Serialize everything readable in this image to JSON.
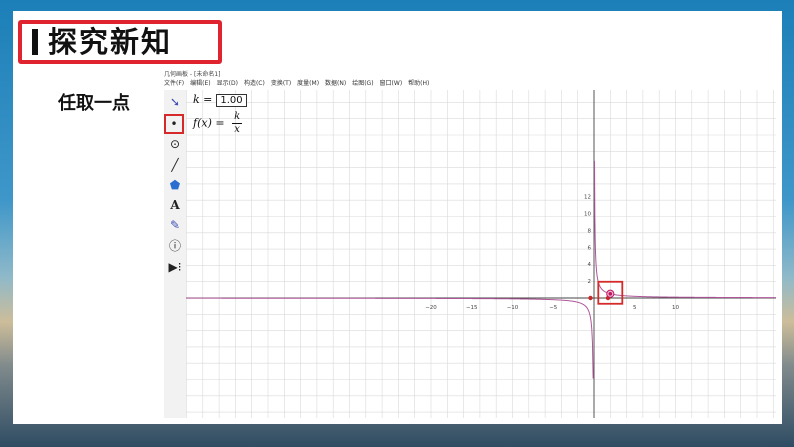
{
  "slide": {
    "title": "探究新知",
    "side_label": "任取一点"
  },
  "window": {
    "title": "几何画板 - [未命名1]",
    "menu": [
      "文件(F)",
      "编辑(E)",
      "显示(D)",
      "构造(C)",
      "变换(T)",
      "度量(M)",
      "数据(N)",
      "绘图(G)",
      "窗口(W)",
      "帮助(H)"
    ]
  },
  "tools": [
    "arrow-select-tool",
    "point-tool",
    "compass-tool",
    "straightedge-tool",
    "polygon-tool",
    "text-tool",
    "marker-tool",
    "info-tool",
    "custom-tool"
  ],
  "tool_glyphs": [
    "➘",
    "•",
    "⊙",
    "╱",
    "⬟",
    "A",
    "✎",
    "ⓘ",
    "▶⁝"
  ],
  "algebra": {
    "k_label": "k =",
    "k_value": "1.00",
    "f_label": "f(x) =",
    "f_num": "k",
    "f_den": "x"
  },
  "graph": {
    "x_ticks": [
      "−20",
      "−15",
      "−10",
      "−5",
      "5",
      "10"
    ],
    "y_ticks": [
      "12",
      "10",
      "8",
      "6",
      "4",
      "2"
    ],
    "k": 1.0,
    "highlight_point_x": 2.0
  },
  "colors": {
    "accent": "#e0242f",
    "curve": "#b0559a",
    "grid": "#d9d9d9",
    "point": "#c2185b"
  }
}
